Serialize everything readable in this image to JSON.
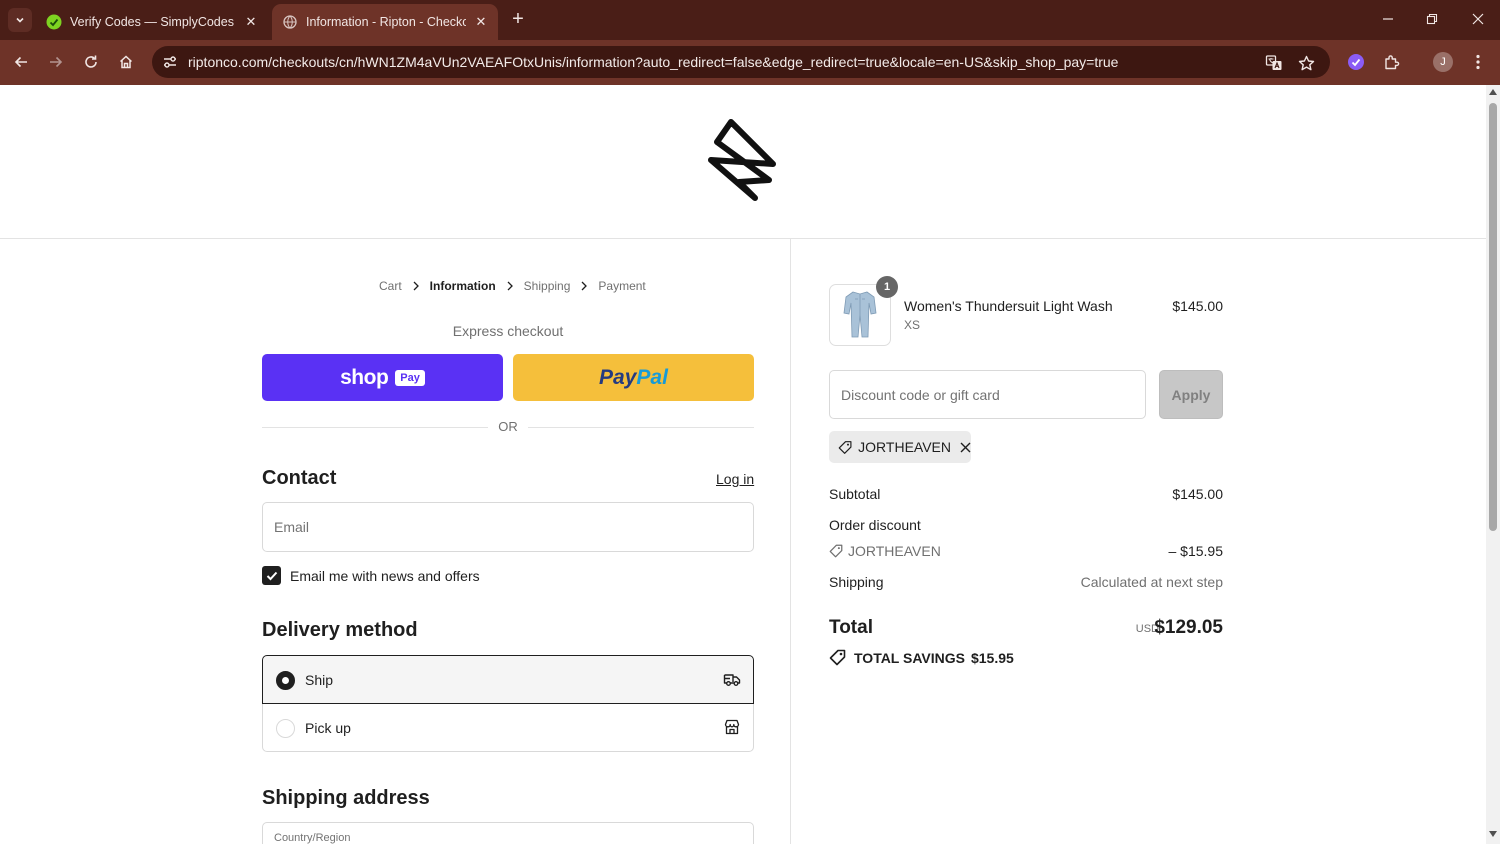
{
  "browser": {
    "tabs": [
      {
        "title": "Verify Codes — SimplyCodes",
        "active": false
      },
      {
        "title": "Information - Ripton - Checkout",
        "active": true
      }
    ],
    "url": "riptonco.com/checkouts/cn/hWN1ZM4aVUn2VAEAFOtxUnis/information?auto_redirect=false&edge_redirect=true&locale=en-US&skip_shop_pay=true",
    "profile_initial": "J",
    "colors": {
      "frame": "#4a1e17",
      "toolbar": "#6e3328",
      "omnibox": "#3d1711"
    }
  },
  "breadcrumb": {
    "cart": "Cart",
    "information": "Information",
    "shipping": "Shipping",
    "payment": "Payment"
  },
  "express": {
    "title": "Express checkout",
    "shop_word": "shop",
    "shop_pay_badge": "Pay",
    "paypal_part1": "Pay",
    "paypal_part2": "Pal",
    "or": "OR"
  },
  "contact": {
    "heading": "Contact",
    "login": "Log in",
    "email_placeholder": "Email",
    "newsletter_label": "Email me with news and offers",
    "newsletter_checked": true
  },
  "delivery": {
    "heading": "Delivery method",
    "options": [
      {
        "label": "Ship",
        "selected": true,
        "icon": "truck-icon"
      },
      {
        "label": "Pick up",
        "selected": false,
        "icon": "store-icon"
      }
    ]
  },
  "shipping_address": {
    "heading": "Shipping address",
    "country_placeholder": "Country/Region"
  },
  "summary": {
    "item": {
      "name": "Women's Thundersuit Light Wash",
      "variant": "XS",
      "price": "$145.00",
      "quantity": "1"
    },
    "discount_placeholder": "Discount code or gift card",
    "apply": "Apply",
    "applied_code": "JORTHEAVEN",
    "subtotal_label": "Subtotal",
    "subtotal_value": "$145.00",
    "order_discount_label": "Order discount",
    "discount_code": "JORTHEAVEN",
    "discount_value": "– $15.95",
    "shipping_label": "Shipping",
    "shipping_value": "Calculated at next step",
    "total_label": "Total",
    "currency": "USD",
    "total_value": "$129.05",
    "savings_label": "TOTAL SAVINGS",
    "savings_value": "$15.95"
  },
  "colors": {
    "shop_pay": "#5a31f4",
    "paypal": "#f5bf3b",
    "text": "#1f1f1f",
    "muted": "#707070"
  }
}
